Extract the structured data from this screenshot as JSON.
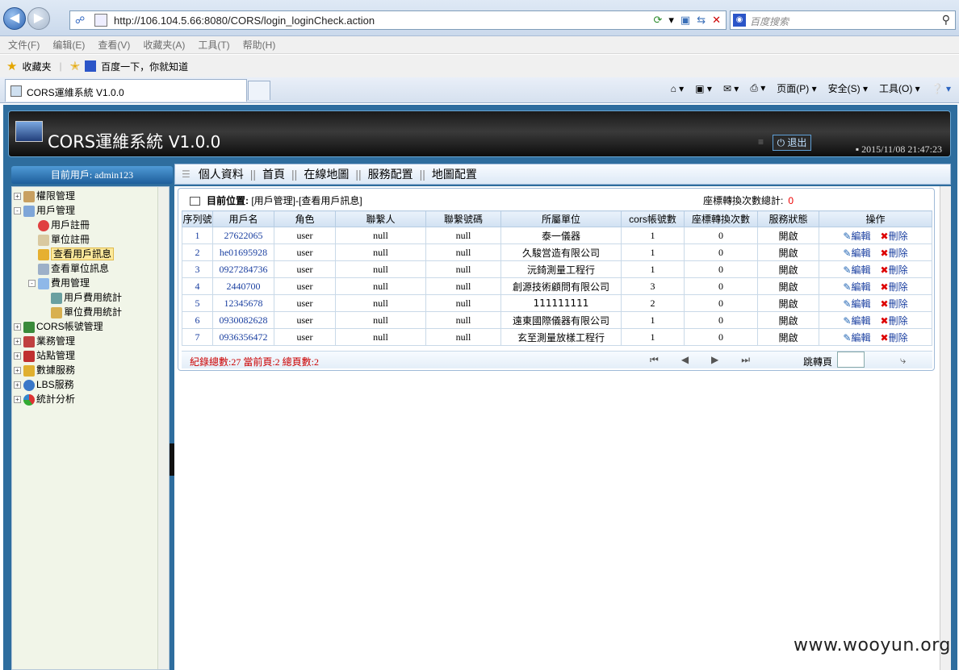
{
  "browser": {
    "url": "http://106.104.5.66:8080/CORS/login_loginCheck.action",
    "search_placeholder": "百度搜索",
    "menu": [
      "文件(F)",
      "编辑(E)",
      "查看(V)",
      "收藏夹(A)",
      "工具(T)",
      "帮助(H)"
    ],
    "favorites_label": "收藏夹",
    "fav_link": "百度一下，你就知道",
    "tab_title": "CORS運維系統 V1.0.0",
    "cmd": {
      "page": "页面(P)",
      "safety": "安全(S)",
      "tools": "工具(O)"
    }
  },
  "app": {
    "title": "CORS運維系統",
    "version": "V1.0.0",
    "exit_label": "退出",
    "datetime": "2015/11/08 21:47:23",
    "current_user": "目前用戶: admin123"
  },
  "topnav": [
    "個人資料",
    "首頁",
    "在線地圖",
    "服務配置",
    "地圖配置"
  ],
  "tree": [
    {
      "label": "權限管理",
      "level": 0,
      "toggle": "+"
    },
    {
      "label": "用戶管理",
      "level": 0,
      "toggle": "-"
    },
    {
      "label": "用戶註冊",
      "level": 1
    },
    {
      "label": "單位註冊",
      "level": 1
    },
    {
      "label": "查看用戶訊息",
      "level": 1,
      "selected": true
    },
    {
      "label": "查看單位訊息",
      "level": 1
    },
    {
      "label": "費用管理",
      "level": 1,
      "toggle": "-"
    },
    {
      "label": "用戶費用統計",
      "level": 2
    },
    {
      "label": "單位費用統計",
      "level": 2
    },
    {
      "label": "CORS帳號管理",
      "level": 0,
      "toggle": "+"
    },
    {
      "label": "業務管理",
      "level": 0,
      "toggle": "+"
    },
    {
      "label": "站點管理",
      "level": 0,
      "toggle": "+"
    },
    {
      "label": "數據服務",
      "level": 0,
      "toggle": "+"
    },
    {
      "label": "LBS服務",
      "level": 0,
      "toggle": "+"
    },
    {
      "label": "統計分析",
      "level": 0,
      "toggle": "+"
    }
  ],
  "panel": {
    "crumb_label": "目前位置:",
    "crumb_path": "[用戶管理]-[查看用戶訊息]",
    "conv_total_label": "座標轉換次數總計:",
    "conv_total_value": "0"
  },
  "table": {
    "headers": [
      "序列號",
      "用戶名",
      "角色",
      "聯繫人",
      "聯繫號碼",
      "所屬單位",
      "cors帳號數",
      "座標轉換次數",
      "服務狀態",
      "操作"
    ],
    "edit_label": "編輯",
    "delete_label": "刪除",
    "rows": [
      [
        "1",
        "27622065",
        "user",
        "null",
        "null",
        "泰一儀器",
        "1",
        "0",
        "開啟"
      ],
      [
        "2",
        "he01695928",
        "user",
        "null",
        "null",
        "久駿営造有限公司",
        "1",
        "0",
        "開啟"
      ],
      [
        "3",
        "0927284736",
        "user",
        "null",
        "null",
        "沅錡測量工程行",
        "1",
        "0",
        "開啟"
      ],
      [
        "4",
        "2440700",
        "user",
        "null",
        "null",
        "創源技術顧問有限公司",
        "3",
        "0",
        "開啟"
      ],
      [
        "5",
        "12345678",
        "user",
        "null",
        "null",
        "111111111",
        "2",
        "0",
        "開啟"
      ],
      [
        "6",
        "0930082628",
        "user",
        "null",
        "null",
        "遠東國際儀器有限公司",
        "1",
        "0",
        "開啟"
      ],
      [
        "7",
        "0936356472",
        "user",
        "null",
        "null",
        "玄至測量放樣工程行",
        "1",
        "0",
        "開啟"
      ]
    ]
  },
  "footer": {
    "stats": "紀錄總數:27  當前頁:2  總頁數:2",
    "jump_label": "跳轉頁"
  },
  "watermark": "www.wooyun.org"
}
